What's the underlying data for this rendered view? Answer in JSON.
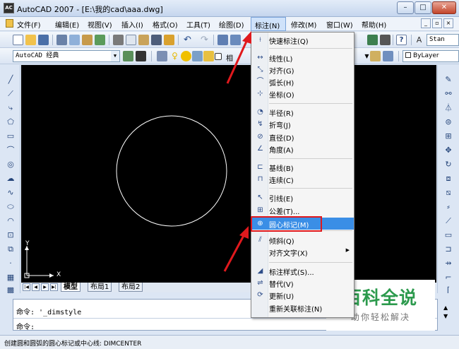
{
  "window": {
    "title": "AutoCAD 2007 - [E:\\我的cad\\aaa.dwg]",
    "icon_text": "AC"
  },
  "window_controls": {
    "minimize": "–",
    "maximize": "□",
    "close": "✕"
  },
  "menubar": {
    "items": [
      "文件(F)",
      "编辑(E)",
      "视图(V)",
      "插入(I)",
      "格式(O)",
      "工具(T)",
      "绘图(D)",
      "标注(N)",
      "修改(M)",
      "窗口(W)",
      "帮助(H)"
    ],
    "active": "标注(N)"
  },
  "mdi_controls": {
    "minimize": "_",
    "restore": "▫",
    "close": "×"
  },
  "toolbar": {
    "workspace_value": "AutoCAD 经典",
    "layer_fragment": "相",
    "style_fragment": "Stan",
    "color_value": "ByLayer"
  },
  "dimension_menu": {
    "items": [
      {
        "label": "快速标注(Q)",
        "icon": "quick-dimension-icon",
        "glyph": "⟊"
      },
      {
        "label": "线性(L)",
        "icon": "linear-dimension-icon",
        "glyph": "↔"
      },
      {
        "label": "对齐(G)",
        "icon": "aligned-dimension-icon",
        "glyph": "⤡"
      },
      {
        "label": "弧长(H)",
        "icon": "arc-length-icon",
        "glyph": "⌒"
      },
      {
        "label": "坐标(O)",
        "icon": "ordinate-icon",
        "glyph": "⊹"
      },
      {
        "label": "半径(R)",
        "icon": "radius-icon",
        "glyph": "◔"
      },
      {
        "label": "折弯(J)",
        "icon": "jogged-icon",
        "glyph": "↯"
      },
      {
        "label": "直径(D)",
        "icon": "diameter-icon",
        "glyph": "⊘"
      },
      {
        "label": "角度(A)",
        "icon": "angular-icon",
        "glyph": "∠"
      },
      {
        "label": "基线(B)",
        "icon": "baseline-icon",
        "glyph": "⊏"
      },
      {
        "label": "连续(C)",
        "icon": "continue-icon",
        "glyph": "⊓"
      },
      {
        "label": "引线(E)",
        "icon": "leader-icon",
        "glyph": "↖"
      },
      {
        "label": "公差(T)...",
        "icon": "tolerance-icon",
        "glyph": "⊞"
      },
      {
        "label": "圆心标记(M)",
        "icon": "center-mark-icon",
        "glyph": "⊕"
      },
      {
        "label": "倾斜(Q)",
        "icon": "oblique-icon",
        "glyph": "⫽"
      },
      {
        "label": "对齐文字(X)",
        "icon": "",
        "glyph": "",
        "submenu": "▶"
      },
      {
        "label": "标注样式(S)...",
        "icon": "dimension-style-icon",
        "glyph": "◢"
      },
      {
        "label": "替代(V)",
        "icon": "override-icon",
        "glyph": "⇌"
      },
      {
        "label": "更新(U)",
        "icon": "update-icon",
        "glyph": "⟳"
      },
      {
        "label": "重新关联标注(N)",
        "icon": "",
        "glyph": ""
      }
    ],
    "highlighted": "圆心标记(M)"
  },
  "layout_tabs": [
    "模型",
    "布局1",
    "布局2"
  ],
  "ucs": {
    "y": "Y",
    "x": "X"
  },
  "command": {
    "line1": "命令: '_dimstyle",
    "line2": "命令:"
  },
  "status": {
    "text": "创建圆和圆弧的圆心标记或中心线:  DIMCENTER"
  },
  "watermark": {
    "title": "百科全说",
    "subtitle": "助你轻松解决"
  },
  "colors": {
    "accent": "#e0191d",
    "highlight": "#3a8ee6",
    "watermark_green": "#2c9a4d",
    "canvas": "#000000"
  }
}
